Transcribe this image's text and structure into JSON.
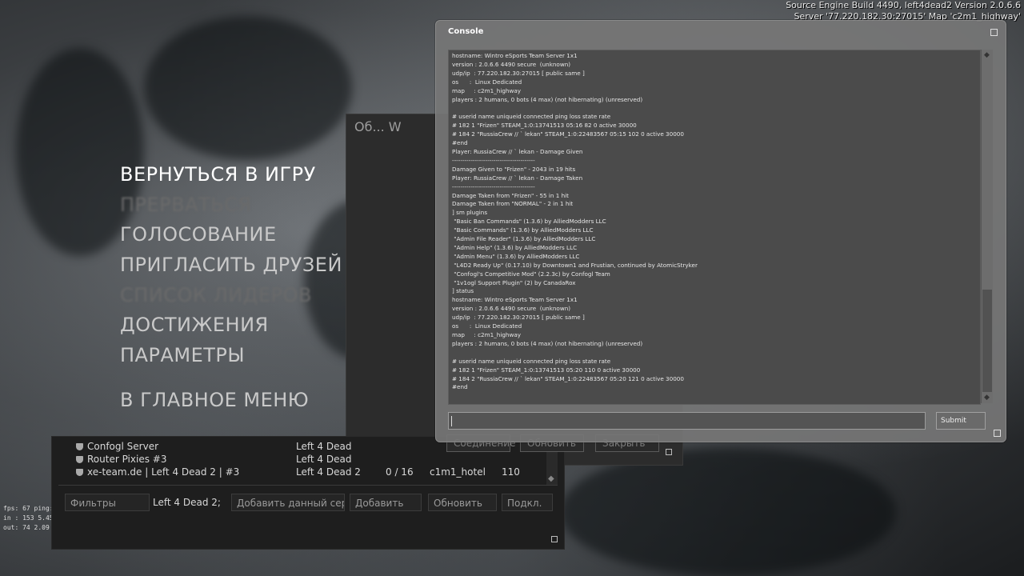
{
  "build_info": {
    "line1": "Source Engine Build 4490, left4dead2 Version 2.0.6.6",
    "line2": "Server '77.220.182.30:27015' Map 'c2m1_highway'"
  },
  "netgraph": {
    "line1": "fps:  67   ping: 0",
    "line2": "in : 153   5.45 k/",
    "line3": "out:  74   2.09 k/"
  },
  "main_menu": {
    "items": [
      {
        "label": "ВЕРНУТЬСЯ В ИГРУ"
      },
      {
        "label": "ПРЕРВАТЬСЯ"
      },
      {
        "label": "ГОЛОСОВАНИЕ"
      },
      {
        "label": "ПРИГЛАСИТЬ ДРУЗЕЙ"
      },
      {
        "label": "СПИСОК ЛИДЕРОВ"
      },
      {
        "label": "ДОСТИЖЕНИЯ"
      },
      {
        "label": "ПАРАМЕТРЫ"
      },
      {
        "label": "В ГЛАВНОЕ МЕНЮ"
      }
    ]
  },
  "ghost_window": {
    "title": "Об...   W"
  },
  "ghost_buttons": {
    "connect": "Соединение",
    "refresh": "Обновить",
    "close": "Закрыть"
  },
  "server_browser": {
    "rows": [
      {
        "name": "Confogl Server",
        "game": "Left 4 Dead",
        "players": "",
        "map": "",
        "ping": ""
      },
      {
        "name": "Router Pixies #3",
        "game": "Left 4 Dead",
        "players": "",
        "map": "",
        "ping": ""
      },
      {
        "name": "xe-team.de | Left 4 Dead 2 | #3",
        "game": "Left 4 Dead 2",
        "players": "0 / 16",
        "map": "c1m1_hotel",
        "ping": "110"
      }
    ],
    "filters_label": "Фильтры",
    "game_filter": "Left 4 Dead 2;",
    "add_current_label": "Добавить данный сер...",
    "add_label": "Добавить",
    "refresh_label": "Обновить",
    "connect_label": "Подкл."
  },
  "console": {
    "title": "Console",
    "submit_label": "Submit",
    "input_value": "",
    "lines": [
      "hostname: Wintro eSports Team Server 1x1",
      "version : 2.0.6.6 4490 secure  (unknown)",
      "udp/ip  : 77.220.182.30:27015 [ public same ]",
      "os      :  Linux Dedicated",
      "map     : c2m1_highway",
      "players : 2 humans, 0 bots (4 max) (not hibernating) (unreserved)",
      "",
      "# userid name uniqueid connected ping loss state rate",
      "# 182 1 \"Frizen\" STEAM_1:0:13741513 05:16 82 0 active 30000",
      "# 184 2 \"RussiaCrew // ` lekan\" STEAM_1:0:22483567 05:15 102 0 active 30000",
      "#end",
      "Player: RussiaCrew // ` lekan - Damage Given",
      "----------------------------------------",
      "Damage Given to \"Frizen\" - 2043 in 19 hits",
      "Player: RussiaCrew // ` lekan - Damage Taken",
      "----------------------------------------",
      "Damage Taken from \"Frizen\" - 55 in 1 hit",
      "Damage Taken from \"NORMAL\" - 2 in 1 hit",
      "] sm plugins",
      " \"Basic Ban Commands\" (1.3.6) by AlliedModders LLC",
      " \"Basic Commands\" (1.3.6) by AlliedModders LLC",
      " \"Admin File Reader\" (1.3.6) by AlliedModders LLC",
      " \"Admin Help\" (1.3.6) by AlliedModders LLC",
      " \"Admin Menu\" (1.3.6) by AlliedModders LLC",
      " \"L4D2 Ready Up\" (0.17.10) by Downtown1 and Frustian, continued by AtomicStryker",
      " \"Confogl's Competitive Mod\" (2.2.3c) by Confogl Team",
      " \"1v1ogl Support Plugin\" (2) by CanadaRox",
      "] status",
      "hostname: Wintro eSports Team Server 1x1",
      "version : 2.0.6.6 4490 secure  (unknown)",
      "udp/ip  : 77.220.182.30:27015 [ public same ]",
      "os      :  Linux Dedicated",
      "map     : c2m1_highway",
      "players : 2 humans, 0 bots (4 max) (not hibernating) (unreserved)",
      "",
      "# userid name uniqueid connected ping loss state rate",
      "# 182 1 \"Frizen\" STEAM_1:0:13741513 05:20 110 0 active 30000",
      "# 184 2 \"RussiaCrew // ` lekan\" STEAM_1:0:22483567 05:20 121 0 active 30000",
      "#end"
    ]
  }
}
